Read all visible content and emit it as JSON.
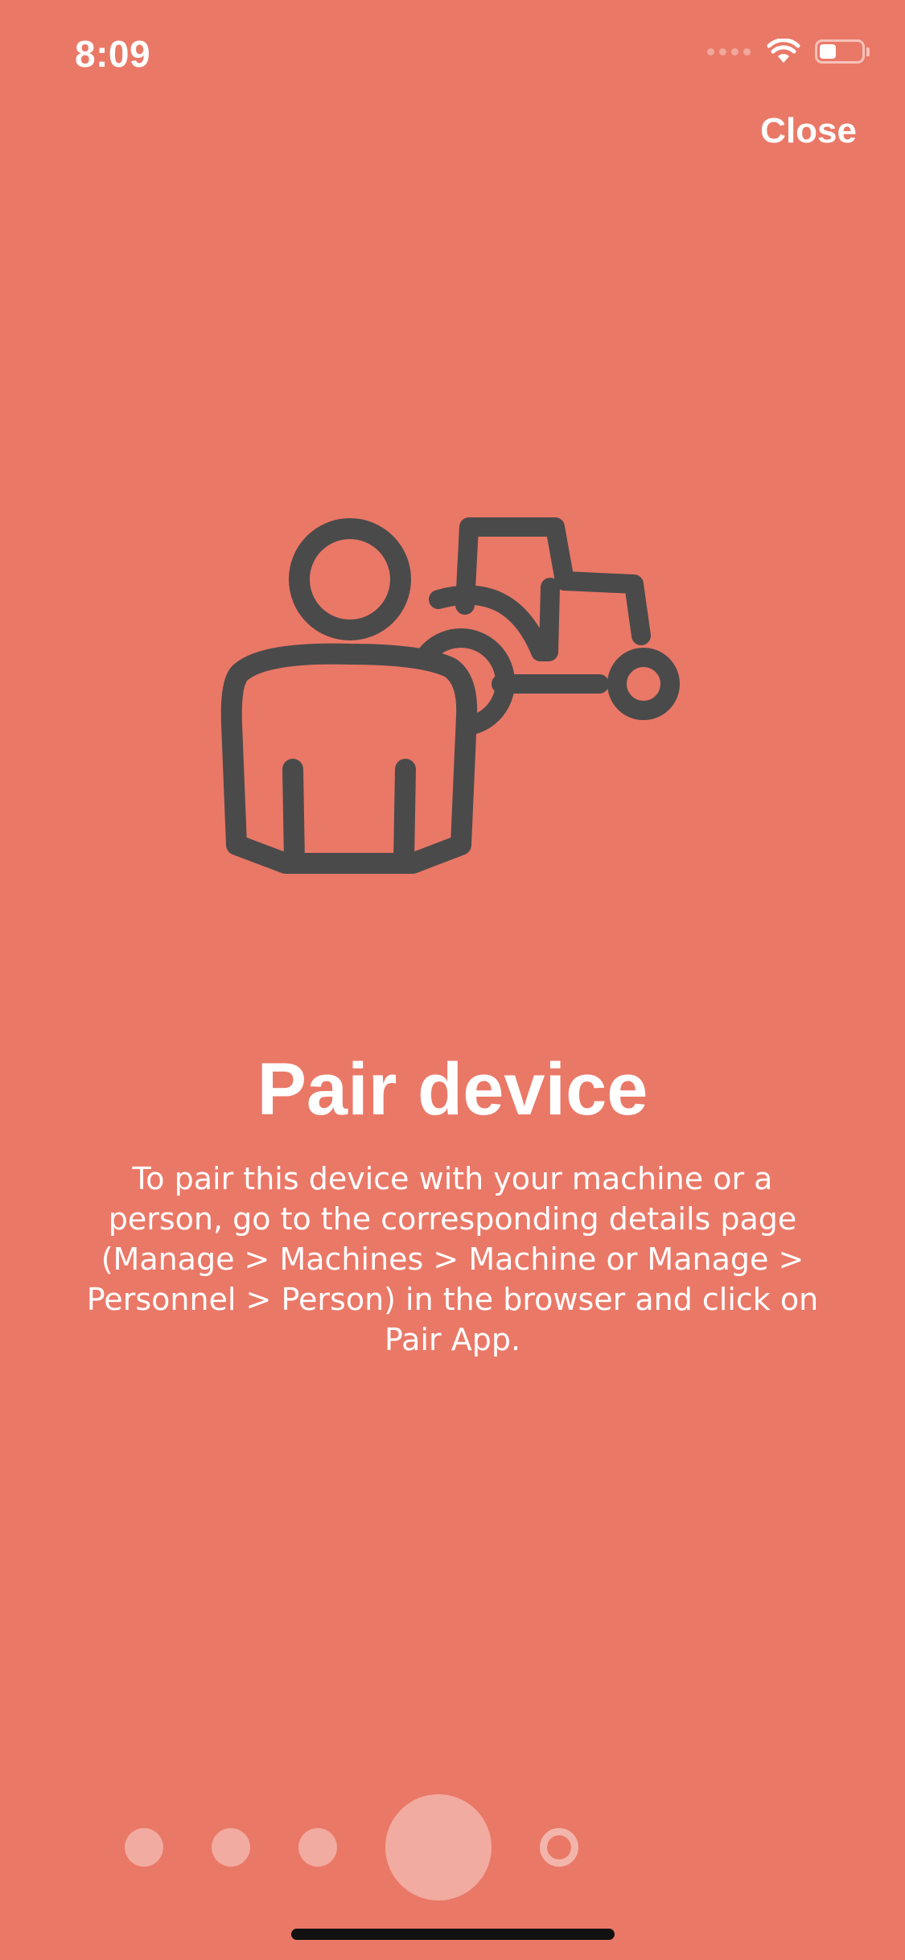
{
  "status_bar": {
    "time": "8:09",
    "battery_level": 0.4
  },
  "header": {
    "close_label": "Close"
  },
  "illustration": {
    "icon": "person-and-tractor-icon",
    "color": "#4a4a4a"
  },
  "content": {
    "title": "Pair device",
    "description": "To pair this device with your machine or a person, go to the corresponding details page (Manage > Machines > Machine or Manage > Personnel > Person) in the browser and click on Pair App."
  },
  "pager": {
    "page_count": 5,
    "current_page": 4
  },
  "colors": {
    "background": "#ea7867",
    "text": "#ffffff",
    "icon": "#4a4a4a"
  }
}
